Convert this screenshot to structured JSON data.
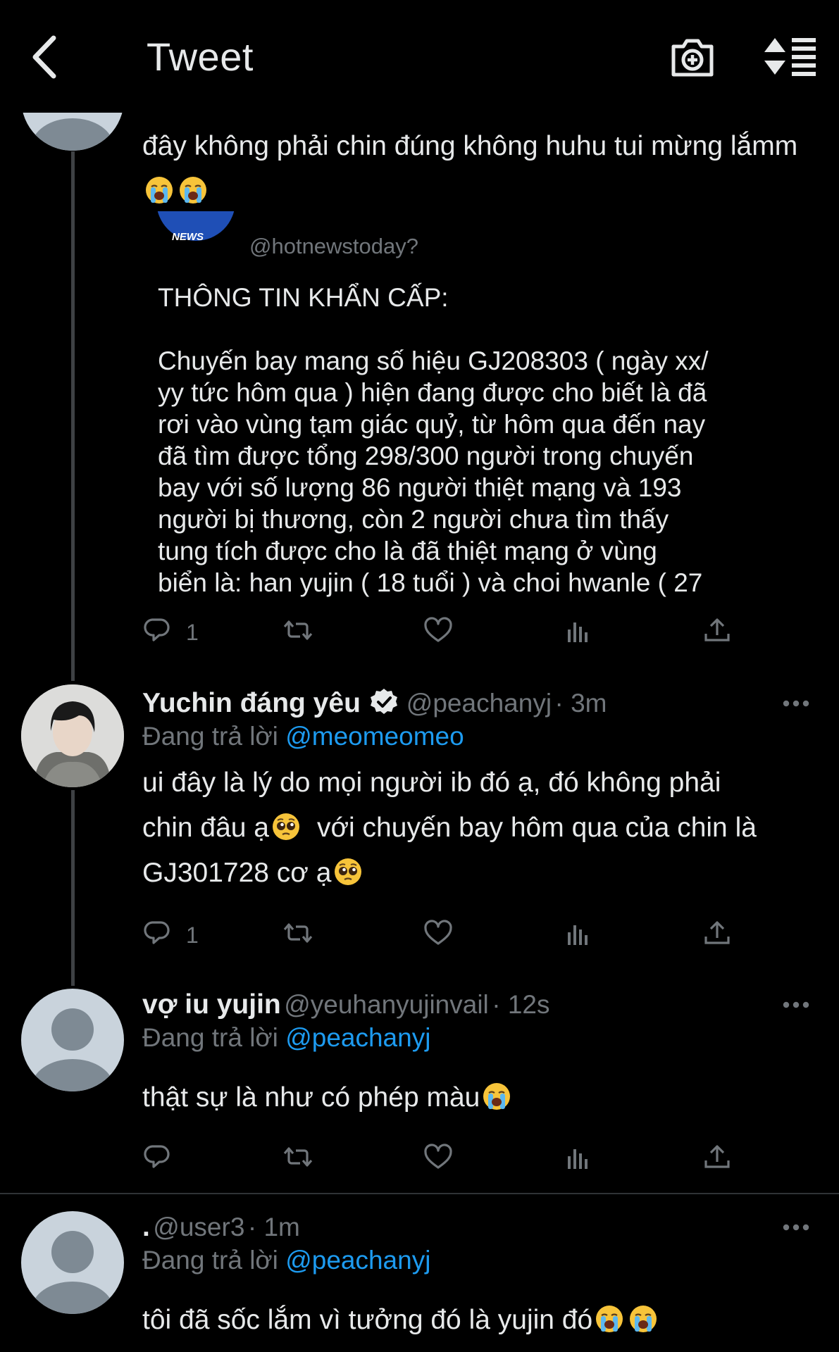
{
  "header": {
    "title": "Tweet"
  },
  "colors": {
    "background": "#000000",
    "text": "#e7e9ea",
    "secondary": "#71767b",
    "accent": "#1d9bf0",
    "thread_line": "#3e4144"
  },
  "icons": {
    "back": "chevron-left-icon",
    "camera": "camera-plus-icon",
    "sort": "sort-icon",
    "reply": "reply-icon",
    "retweet": "retweet-icon",
    "like": "heart-icon",
    "views": "views-icon",
    "share": "share-icon",
    "more": "more-icon",
    "verified": "verified-badge-icon",
    "emoji_cry": "loudly-crying-face-emoji",
    "emoji_plead": "pleading-face-emoji"
  },
  "tweet1": {
    "text": "đây không phải chin đúng không huhu tui mừng lắmm",
    "quote": {
      "avatar_text": "NEWS",
      "handle": "@hotnewstoday?",
      "body": "THÔNG TIN KHẨN CẤP:\n\nChuyến bay mang số hiệu GJ208303 ( ngày xx/\nyy tức hôm qua ) hiện đang được cho biết là đã\nrơi vào vùng tạm giác quỷ, từ hôm qua đến nay\nđã tìm được tổng 298/300 người trong chuyến\nbay với số lượng 86 người thiệt mạng và 193\nngười bị thương, còn 2 người chưa tìm thấy\ntung tích được cho là đã thiệt mạng ở vùng\nbiển là: han yujin ( 18 tuổi ) và choi hwanle ( 27"
    },
    "reply_count": "1"
  },
  "tweet2": {
    "name": "Yuchin đáng yêu",
    "handle": "@peachanyj",
    "time": "· 3m",
    "reply_prefix": "Đang trả lời",
    "reply_to": "@meomeomeo",
    "line1": "ui đây là lý do mọi người ib đó ạ, đó không phải",
    "line2a": "chin đâu ạ",
    "line2b": "với chuyến bay hôm qua của chin là",
    "line3": "GJ301728 cơ ạ",
    "reply_count": "1"
  },
  "tweet3": {
    "name": "vợ iu yujin",
    "handle": "@yeuhanyujinvail",
    "time": "· 12s",
    "reply_prefix": "Đang trả lời",
    "reply_to": "@peachanyj",
    "text": "thật sự là như có phép màu"
  },
  "tweet4": {
    "name": ".",
    "handle": "@user3",
    "time": "· 1m",
    "reply_prefix": "Đang trả lời",
    "reply_to": "@peachanyj",
    "text": "tôi đã sốc lắm vì tưởng đó là yujin đó"
  }
}
